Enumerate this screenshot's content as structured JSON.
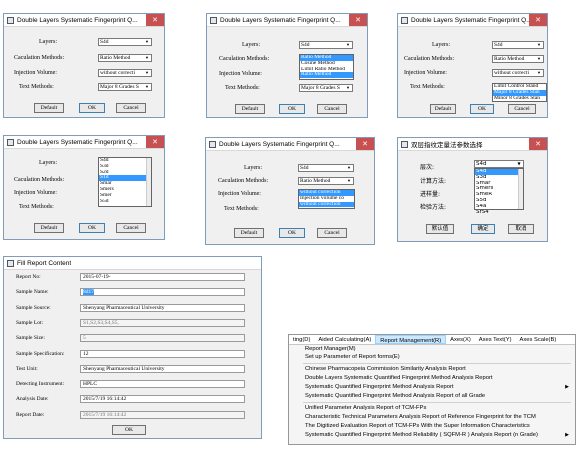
{
  "dialog_title": "Double Layers Systematic  Fingerprint Q...",
  "labels": {
    "layers": "Layers:",
    "calc": "Caculation Methods:",
    "inj": "Injection Volume:",
    "test": "Text Methods:"
  },
  "buttons": {
    "default": "Default",
    "ok": "OK",
    "cancel": "Cancel"
  },
  "values": {
    "layers": "S4d",
    "calc": "Ratio Method",
    "inj": "without correcti",
    "test": "Major 8 Grades S"
  },
  "calc_options": [
    "Ratio Method",
    "Cosine Method",
    "Limit Ratio Method",
    "Ratio Method"
  ],
  "test_options": [
    "Limit Control Stand",
    "Major 8 Grades Stan",
    "Minor 8 Grades Stan"
  ],
  "layer_options": [
    "S4d",
    "S3d",
    "S2d",
    "S1d",
    "Smar",
    "Smers",
    "Smer",
    "S5d",
    "S4a",
    "SrS4"
  ],
  "inj_options": [
    "without correction",
    "Injection volume co",
    "without correction"
  ],
  "cn": {
    "title": "双层指纹定量法参数选择",
    "layers": "层次:",
    "calc": "计算方法:",
    "select": "进样量:",
    "test": "检验方法:",
    "default": "默认值",
    "ok": "确定",
    "cancel": "取消",
    "layer_value": "S4d",
    "layer_options": [
      "S4d",
      "S3d",
      "Smar",
      "Smers",
      "SmeR",
      "S5d",
      "S4a",
      "SrS4",
      "S104"
    ]
  },
  "report": {
    "title": "Fill Report Content",
    "fields": [
      {
        "label": "Report  No:",
        "value": "2015-07-19-",
        "dis": false,
        "hl": false
      },
      {
        "label": "Sample Name:",
        "value": "8d17",
        "dis": false,
        "hl": true
      },
      {
        "label": "Sample Source:",
        "value": "Shenyang Pharmaceutical University",
        "dis": false,
        "hl": false
      },
      {
        "label": "Sample Lot:",
        "value": "S1,S2,S3,S4,S5,",
        "dis": true,
        "hl": false
      },
      {
        "label": "Sample Size:",
        "value": "5",
        "dis": true,
        "hl": false
      },
      {
        "label": "Sample Specification:",
        "value": "12",
        "dis": false,
        "hl": false
      },
      {
        "label": "Test Unit:",
        "value": "Shenyang Pharmaceutical University",
        "dis": false,
        "hl": false
      },
      {
        "label": "Detecting Instrument:",
        "value": "HPLC",
        "dis": false,
        "hl": false
      },
      {
        "label": "Analysis Date:",
        "value": "2015/7/19 16:14:42",
        "dis": false,
        "hl": false
      },
      {
        "label": "Report Date:",
        "value": "2015/7/19 16:14:42",
        "dis": true,
        "hl": false
      }
    ],
    "ok": "OK"
  },
  "menu": {
    "bar": [
      "ting(D)",
      "Aided Calculating(A)",
      "Report Management(R)",
      "Axes(X)",
      "Axes Text(Y)",
      "Axes Scale(B)"
    ],
    "items": [
      "Report Manager(M)",
      "Set up Parameter of Report forms(E)",
      "Chinese Pharmacopeia Commission Similarity Analysis Report",
      "Double Layers Systematic Quantified Fingerprint Method Analysis Report",
      "Systematic Quantified Fingerprint Method  Analysis Report",
      "Systematic Quantified Fingerprint Method Analysis Report of all Grade",
      "Unified Parameter Analysis Report of TCM-FPs",
      "Characteristic Technical Parameters Analysis Report of  Reference Fingerprint for the TCM",
      "The Digitized Evaluation Report of TCM-FPs With the Super Information Characteristics",
      "Systematic Quantified Fingerprint Method Reliability ( SQFM-R ) Analysis Report (n Grade)"
    ]
  }
}
